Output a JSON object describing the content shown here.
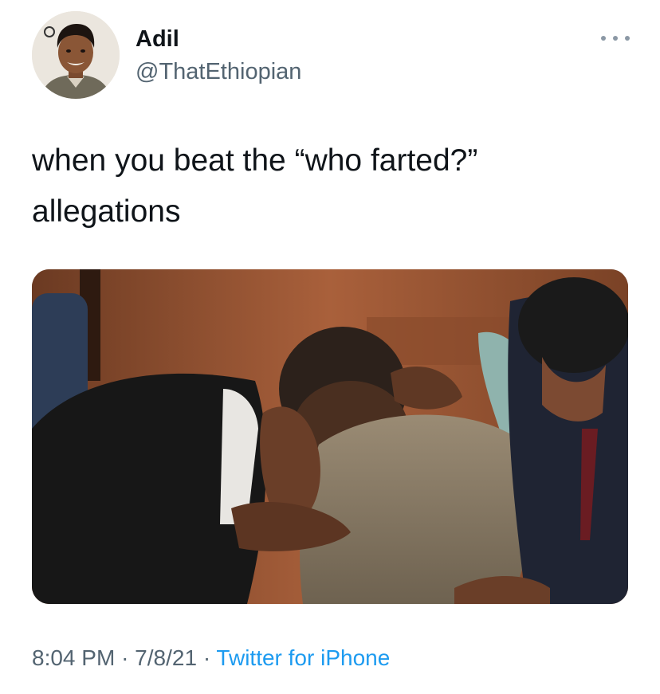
{
  "tweet": {
    "author_name": "Adil",
    "author_handle": "@ThatEthiopian",
    "text_lines": [
      "when you beat the “who farted?”",
      "allegations"
    ],
    "time": "8:04 PM",
    "separator": "·",
    "date": "7/8/21",
    "source": "Twitter for iPhone"
  },
  "icons": {
    "more": "more-dots-icon"
  },
  "colors": {
    "text": "#0f1419",
    "secondary": "#536471",
    "link": "#1d9bf0"
  }
}
